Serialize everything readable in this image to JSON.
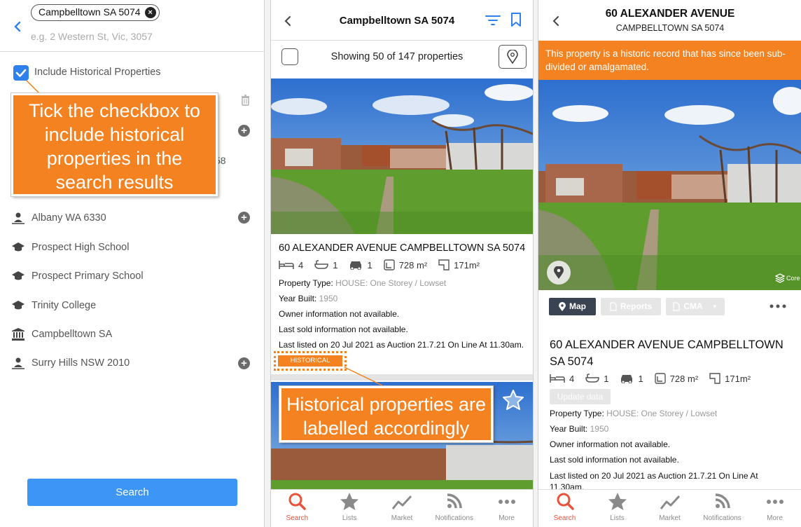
{
  "panel1": {
    "location_chip": "Campbelltown SA 5074",
    "search_placeholder": "e.g. 2 Western St, Vic, 3057",
    "include_historical_label": "Include Historical Properties",
    "include_historical_checked": true,
    "callout_lines": [
      "Tick the checkbox to",
      "include historical",
      "properties in the",
      "search results"
    ],
    "partial_text": "58",
    "recent_items": [
      {
        "label": "Albany WA 6330",
        "icon": "person-location-icon",
        "addable": true
      },
      {
        "label": "Prospect High School",
        "icon": "school-icon",
        "addable": false
      },
      {
        "label": "Prospect Primary School",
        "icon": "school-icon",
        "addable": false
      },
      {
        "label": "Trinity College",
        "icon": "school-icon",
        "addable": false
      },
      {
        "label": "Campbelltown SA",
        "icon": "council-building-icon",
        "addable": false
      },
      {
        "label": "Surry Hills NSW 2010",
        "icon": "person-location-icon",
        "addable": true
      }
    ],
    "search_button": "Search"
  },
  "panel2": {
    "header_title": "Campbelltown SA 5074",
    "showing_text": "Showing 50 of 147 properties",
    "property": {
      "address": "60 ALEXANDER AVENUE CAMPBELLTOWN SA 5074",
      "beds": "4",
      "baths": "1",
      "cars": "1",
      "land": "728 m²",
      "floor": "171m²",
      "type_label": "Property Type:",
      "type_value": "HOUSE: One Storey / Lowset",
      "year_label": "Year Built:",
      "year_value": "1950",
      "owner_info": "Owner information not available.",
      "last_sold": "Last sold information not available.",
      "last_listed": "Last listed on 20 Jul 2021 as Auction 21.7.21 On Line At 11.30am.",
      "badge": "HISTORICAL"
    },
    "callout_lines": [
      "Historical properties are",
      "labelled accordingly"
    ]
  },
  "panel3": {
    "header_title": "60 ALEXANDER AVENUE",
    "header_subtitle": "CAMPBELLTOWN SA 5074",
    "banner": "This property is a historic record that has since been sub-divided or amalgamated.",
    "watermark": "Core",
    "buttons": {
      "map": "Map",
      "reports": "Reports",
      "cma": "CMA"
    },
    "address_line1": "60 ALEXANDER AVENUE CAMPBELLTOWN",
    "address_line2": "SA 5074",
    "beds": "4",
    "baths": "1",
    "cars": "1",
    "land": "728 m²",
    "floor": "171m²",
    "update_data": "Update data",
    "type_label": "Property Type:",
    "type_value": "HOUSE: One Storey / Lowset",
    "year_label": "Year Built:",
    "year_value": "1950",
    "owner_info": "Owner information not available.",
    "last_sold": "Last sold information not available.",
    "last_listed_line1": "Last listed on 20 Jul 2021 as Auction 21.7.21 On Line At",
    "last_listed_line2": "11.30am."
  },
  "tabs": [
    "Search",
    "Lists",
    "Market",
    "Notifications",
    "More"
  ],
  "active_tab": "Search",
  "colors": {
    "accent_orange": "#f58220",
    "brand_blue": "#2f80ed",
    "active_tab": "#e8533a"
  }
}
